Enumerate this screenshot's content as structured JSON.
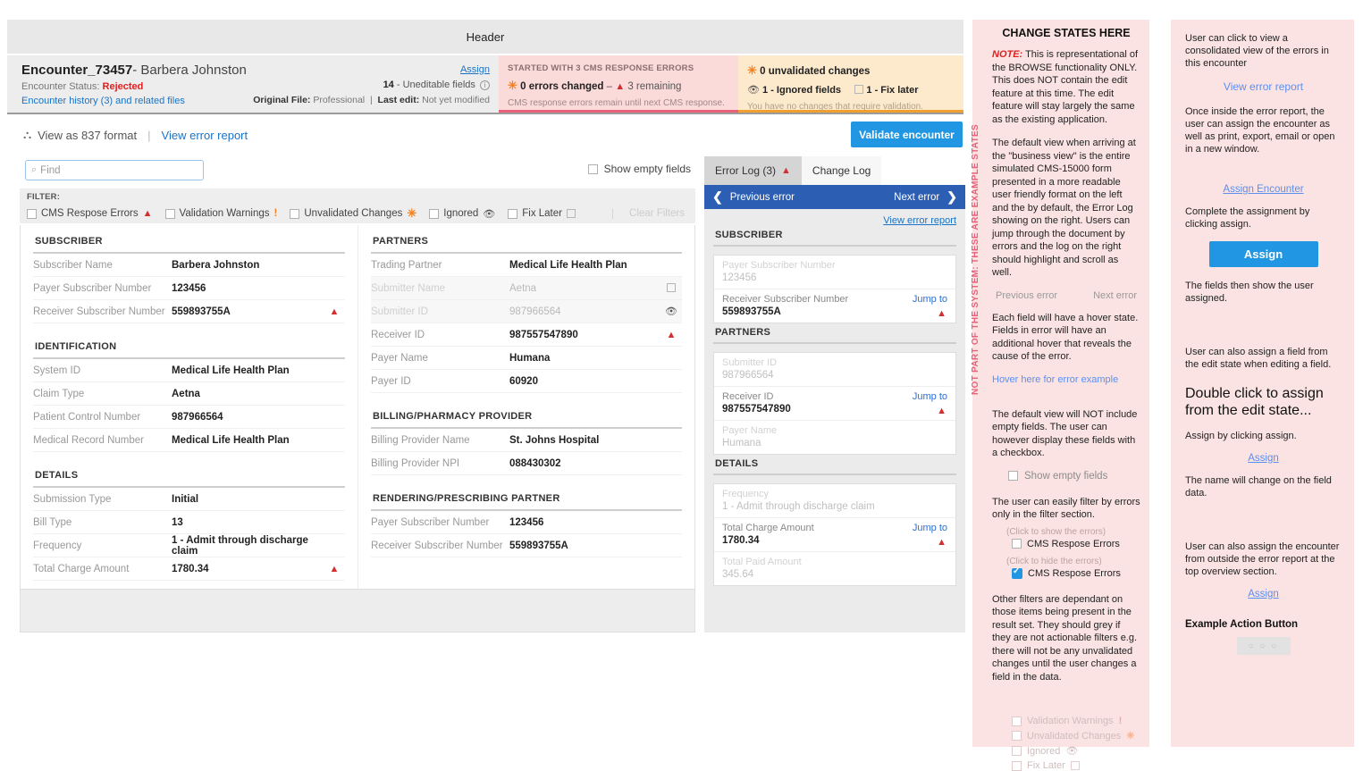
{
  "header": {
    "title": "Header"
  },
  "overview": {
    "encounter_id": "Encounter_73457",
    "encounter_name": "- Barbera Johnston",
    "status_label": "Encounter Status:",
    "status_value": "Rejected",
    "history_link": "Encounter history (3) and related files",
    "assign_link": "Assign",
    "uneditable_count": "14",
    "uneditable_label": "- Uneditable fields",
    "original_file_label": "Original File:",
    "original_file_value": "Professional",
    "last_edit_label": "Last edit:",
    "last_edit_value": "Not yet modified",
    "cms_banner": {
      "caption": "STARTED WITH 3 CMS RESPONSE ERRORS",
      "errors_changed": "0 errors changed",
      "dash": "–",
      "remaining": "3 remaining",
      "footnote": "CMS response errors remain until next CMS response."
    },
    "changes_banner": {
      "unvalidated": "0 unvalidated changes",
      "ignored": "1 - Ignored fields",
      "fix_later": "1 - Fix later",
      "footnote": "You have no changes that require validation."
    }
  },
  "toolbar": {
    "format_icon": "network-icon",
    "format_label": "View as 837 format",
    "separator": "|",
    "error_report_link": "View error report",
    "validate_button": "Validate encounter"
  },
  "search": {
    "placeholder": "Find",
    "value": "",
    "icon": "search-icon"
  },
  "show_empty_fields": {
    "label": "Show empty fields",
    "checked": false
  },
  "filter": {
    "title": "FILTER:",
    "clear_label": "Clear Filters",
    "items": [
      {
        "label": "CMS Respose Errors",
        "icon": "warning-triangle-icon",
        "checked": false
      },
      {
        "label": "Validation Warnings",
        "icon": "exclamation-icon",
        "checked": false
      },
      {
        "label": "Unvalidated Changes",
        "icon": "asterisk-icon",
        "checked": false
      },
      {
        "label": "Ignored",
        "icon": "eye-slash-icon",
        "checked": false
      },
      {
        "label": "Fix Later",
        "icon": "checkbox-icon",
        "checked": false
      }
    ]
  },
  "data_left": [
    {
      "section": "SUBSCRIBER",
      "rows": [
        {
          "key": "Subscriber Name",
          "value": "Barbera Johnston",
          "icon": "",
          "dim": false
        },
        {
          "key": "Payer Subscriber Number",
          "value": "123456",
          "icon": "",
          "dim": false
        },
        {
          "key": "Receiver Subscriber Number",
          "value": "559893755A",
          "icon": "warning-triangle-icon",
          "dim": false
        }
      ]
    },
    {
      "section": "IDENTIFICATION",
      "rows": [
        {
          "key": "System ID",
          "value": "Medical Life Health Plan",
          "icon": "",
          "dim": false
        },
        {
          "key": "Claim Type",
          "value": "Aetna",
          "icon": "",
          "dim": false
        },
        {
          "key": "Patient Control Number",
          "value": "987966564",
          "icon": "",
          "dim": false
        },
        {
          "key": "Medical Record Number",
          "value": "Medical Life Health Plan",
          "icon": "",
          "dim": false
        }
      ]
    },
    {
      "section": "DETAILS",
      "rows": [
        {
          "key": "Submission Type",
          "value": "Initial",
          "icon": "",
          "dim": false
        },
        {
          "key": "Bill Type",
          "value": "13",
          "icon": "",
          "dim": false
        },
        {
          "key": "Frequency",
          "value": "1 - Admit through discharge claim",
          "icon": "",
          "dim": false
        },
        {
          "key": "Total Charge Amount",
          "value": "1780.34",
          "icon": "warning-triangle-icon",
          "dim": false
        }
      ]
    }
  ],
  "data_right": [
    {
      "section": "PARTNERS",
      "rows": [
        {
          "key": "Trading Partner",
          "value": "Medical Life Health Plan",
          "icon": "",
          "dim": false
        },
        {
          "key": "Submitter Name",
          "value": "Aetna",
          "icon": "checkbox-icon",
          "dim": true
        },
        {
          "key": "Submitter ID",
          "value": "987966564",
          "icon": "eye-slash-icon",
          "dim": true
        },
        {
          "key": "Receiver ID",
          "value": "987557547890",
          "icon": "warning-triangle-icon",
          "dim": false
        },
        {
          "key": "Payer Name",
          "value": "Humana",
          "icon": "",
          "dim": false
        },
        {
          "key": "Payer ID",
          "value": "60920",
          "icon": "",
          "dim": false
        }
      ]
    },
    {
      "section": "BILLING/PHARMACY PROVIDER",
      "rows": [
        {
          "key": "Billing Provider Name",
          "value": "St. Johns Hospital",
          "icon": "",
          "dim": false
        },
        {
          "key": "Billing Provider NPI",
          "value": "088430302",
          "icon": "",
          "dim": false
        }
      ]
    },
    {
      "section": "RENDERING/PRESCRIBING PARTNER",
      "rows": [
        {
          "key": "Payer Subscriber Number",
          "value": "123456",
          "icon": "",
          "dim": false
        },
        {
          "key": "Receiver Subscriber Number",
          "value": "559893755A",
          "icon": "",
          "dim": false
        }
      ]
    }
  ],
  "error_log": {
    "tab_error": "Error Log (3)",
    "tab_change": "Change Log",
    "prev_error": "Previous error",
    "next_error": "Next error",
    "view_error_report": "View error report",
    "sections": [
      {
        "section": "SUBSCRIBER",
        "rows": [
          {
            "label": "Payer Subscriber Number",
            "value": "123456",
            "dim": true,
            "jump": "",
            "error": false
          },
          {
            "label": "Receiver Subscriber Number",
            "value": "559893755A",
            "dim": false,
            "jump": "Jump to",
            "error": true
          }
        ]
      },
      {
        "section": "PARTNERS",
        "rows": [
          {
            "label": "Submitter ID",
            "value": "987966564",
            "dim": true,
            "jump": "",
            "error": false
          },
          {
            "label": "Receiver ID",
            "value": "987557547890",
            "dim": false,
            "jump": "Jump to",
            "error": true
          },
          {
            "label": "Payer Name",
            "value": "Humana",
            "dim": true,
            "jump": "",
            "error": false
          }
        ]
      },
      {
        "section": "DETAILS",
        "rows": [
          {
            "label": "Frequency",
            "value": "1 - Admit through discharge claim",
            "dim": true,
            "jump": "",
            "error": false
          },
          {
            "label": "Total Charge Amount",
            "value": "1780.34",
            "dim": false,
            "jump": "Jump to",
            "error": true
          },
          {
            "label": "Total Paid Amount",
            "value": "345.64",
            "dim": true,
            "jump": "",
            "error": false
          }
        ]
      }
    ]
  },
  "annotations_1": {
    "rotated_label": "NOT PART OF THE SYSTEM: THESE ARE EXAMPLE STATES",
    "title": "CHANGE STATES HERE",
    "note_prefix": "NOTE:",
    "note_body": " This is representational of the BROWSE functionality ONLY. This does NOT contain the edit feature at this time. The edit feature will stay largely the same as the existing application.",
    "para_default_view": "The default view when arriving at the \"business view\" is the entire simulated CMS-15000 form presented in a more readable user friendly format on the left and the by default, the Error Log showing on the right. Users can jump through the document by errors and the log on the right should highlight and scroll as well.",
    "prev_error": "Previous error",
    "next_error": "Next error",
    "para_hover": "Each field will have a hover state. Fields in error will have an additional hover that reveals the cause of the error.",
    "hover_link": "Hover here for error example",
    "para_empty": "The default view will NOT include empty fields. The user can however display these fields with a checkbox.",
    "show_empty_label": "Show empty fields",
    "para_filter": "The user can easily filter by errors only in the filter section.",
    "click_show": "(Click to show the errors)",
    "filter_unchecked_label": "CMS Respose Errors",
    "click_hide": "(Click to hide the errors)",
    "filter_checked_label": "CMS Respose Errors",
    "para_other_filters": "Other filters are dependant on those items being present in the result set. They should grey if they are not actionable filters e.g. there will not be any unvalidated changes until the user changes a field in the data.",
    "greyed_filters": [
      {
        "label": "Validation Warnings",
        "icon": "exclamation-icon"
      },
      {
        "label": "Unvalidated Changes",
        "icon": "asterisk-icon"
      },
      {
        "label": "Ignored",
        "icon": "eye-slash-icon"
      },
      {
        "label": "Fix Later",
        "icon": "checkbox-icon"
      }
    ]
  },
  "annotations_2": {
    "para_1": "User can click to view a consolidated view of the errors in this encounter",
    "link_view_error_report": "View error report",
    "para_2": "Once inside the error report, the user can assign the encounter as well as print, export, email or open in a new window.",
    "link_assign_encounter": "Assign Encounter",
    "para_3": "Complete the assignment by clicking assign.",
    "btn_assign": "Assign",
    "para_4": "The fields then show the user assigned.",
    "para_5": "User can also assign a field from the edit state when editing a field.",
    "heading_dblclick": "Double click to assign from the edit state...",
    "para_6": "Assign by clicking assign.",
    "link_assign_1": "Assign",
    "para_7": "The name will change on the field data.",
    "para_8": "User can also assign the encounter from outside the error report at the top overview section.",
    "link_assign_2": "Assign",
    "label_example_action": "Example Action Button",
    "btn_dots": "○ ○ ○"
  },
  "colors": {
    "accent_blue": "#2196e3",
    "link_blue": "#1a73c7",
    "error_red": "#d32f2f",
    "orange": "#f5821f",
    "nav_blue": "#2c5fb3",
    "pink_bg": "#fbe3e3",
    "cms_banner_bg": "#fbdada",
    "changes_banner_bg": "#fdeacd"
  }
}
